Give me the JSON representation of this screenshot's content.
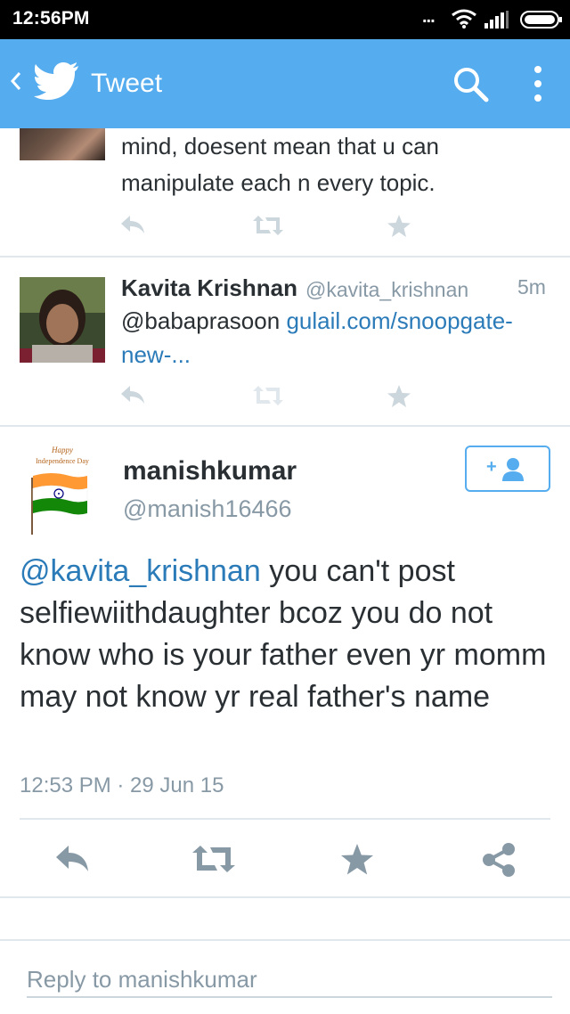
{
  "status_bar": {
    "time": "12:56PM",
    "more_indicator": "...",
    "icons": [
      "wifi-icon",
      "signal-icon",
      "battery-icon"
    ]
  },
  "app_bar": {
    "title": "Tweet",
    "color": "#55acee",
    "icons": [
      "back-icon",
      "twitter-bird-icon",
      "search-icon",
      "more-vert-icon"
    ]
  },
  "tweets": [
    {
      "text_line1": "mind, doesent mean that u can",
      "text_line2": "manipulate each n every topic."
    },
    {
      "name": "Kavita Krishnan",
      "handle": "@kavita_krishnan",
      "time": "5m",
      "mention": "@babaprasoon",
      "link_part1": "gulail.com/snoopgate-",
      "link_part2": "new-..."
    }
  ],
  "main_tweet": {
    "avatar_caption_line1": "Happy",
    "avatar_caption_line2": "Independence Day",
    "name": "manishkumar",
    "handle": "@manish16466",
    "mention": "@kavita_krishnan",
    "text": " you can't post selfiewiithdaughter bcoz you do not know who is your father even yr momm may not know yr real father's name",
    "timestamp": "12:53 PM · 29 Jun 15"
  },
  "reply": {
    "placeholder": "Reply to manishkumar"
  },
  "colors": {
    "accent": "#55acee",
    "link": "#2b7bb9",
    "muted": "#8899a6",
    "text": "#292f33",
    "action_icon": "#8899a6",
    "action_icon_light": "#ccd6dd"
  }
}
